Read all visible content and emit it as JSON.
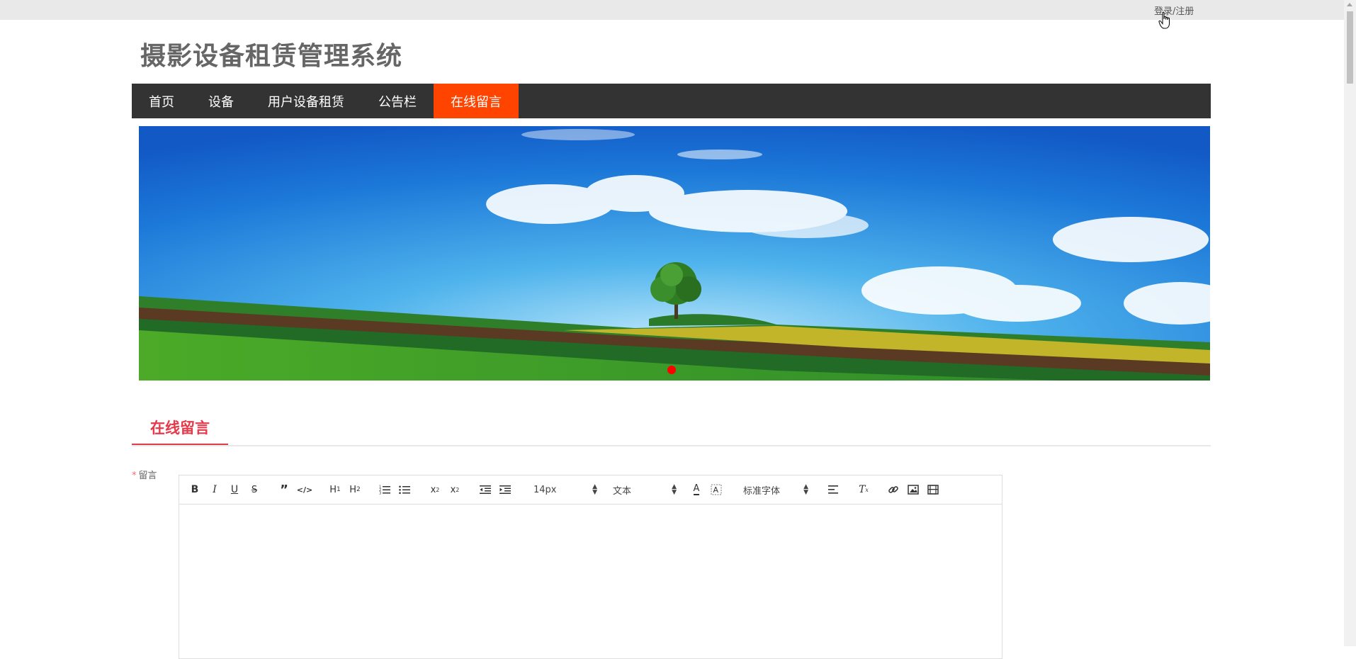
{
  "topbar": {
    "login_label": "登录/注册"
  },
  "site": {
    "title": "摄影设备租赁管理系统"
  },
  "nav": {
    "items": [
      {
        "label": "首页"
      },
      {
        "label": "设备"
      },
      {
        "label": "用户设备租赁"
      },
      {
        "label": "公告栏"
      },
      {
        "label": "在线留言"
      }
    ],
    "active_index": 4,
    "active_color": "#ff4400",
    "bar_color": "#333333"
  },
  "banner": {
    "image": "landscape-tree-meadow-sky",
    "indicator_color": "#ff0000"
  },
  "section": {
    "title": "在线留言",
    "accent_color": "#e6394a"
  },
  "form": {
    "message_label": "留言",
    "required_mark": "*",
    "editor": {
      "toolbar": {
        "font_size": "14px",
        "paragraph": "文本",
        "font_family": "标准字体",
        "buttons": [
          "bold-icon",
          "italic-icon",
          "underline-icon",
          "strike-icon",
          "blockquote-icon",
          "code-icon",
          "h1-icon",
          "h2-icon",
          "ordered-list-icon",
          "bullet-list-icon",
          "subscript-icon",
          "superscript-icon",
          "outdent-icon",
          "indent-icon",
          "font-color-icon",
          "background-color-icon",
          "align-icon",
          "clear-format-icon",
          "link-icon",
          "image-icon",
          "video-icon"
        ]
      },
      "content": ""
    }
  }
}
